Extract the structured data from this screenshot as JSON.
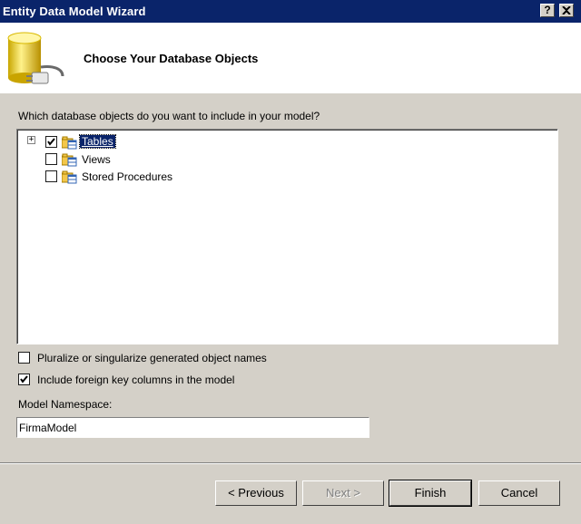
{
  "window": {
    "title": "Entity Data Model Wizard",
    "help_label": "?",
    "close_label": "X"
  },
  "header": {
    "title": "Choose Your Database Objects",
    "icon": "database-plug-icon"
  },
  "prompt": "Which database objects do you want to include in your model?",
  "tree": {
    "expander_symbol": "+",
    "items": [
      {
        "label": "Tables",
        "checked": true,
        "selected": true,
        "expandable": true
      },
      {
        "label": "Views",
        "checked": false,
        "selected": false,
        "expandable": false
      },
      {
        "label": "Stored Procedures",
        "checked": false,
        "selected": false,
        "expandable": false
      }
    ]
  },
  "options": {
    "pluralize": {
      "label": "Pluralize or singularize generated object names",
      "checked": false
    },
    "foreign_keys": {
      "label": "Include foreign key columns in the model",
      "checked": true
    }
  },
  "namespace": {
    "label": "Model Namespace:",
    "value": "FirmaModel"
  },
  "buttons": {
    "previous": "< Previous",
    "next": "Next >",
    "finish": "Finish",
    "cancel": "Cancel"
  },
  "colors": {
    "titlebar": "#0a246a",
    "dialog": "#d4d0c8",
    "selection": "#0a246a"
  }
}
